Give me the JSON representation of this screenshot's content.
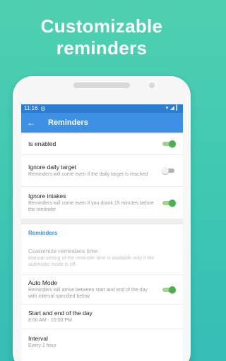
{
  "headline": {
    "line1": "Customizable",
    "line2": "reminders"
  },
  "status_bar": {
    "time": "11:16",
    "app_icon": "notification-icon",
    "icons": [
      "wifi-icon",
      "signal-icon",
      "battery-icon"
    ]
  },
  "app_bar": {
    "back_icon": "arrow-left-icon",
    "title": "Reminders"
  },
  "settings": [
    {
      "title": "Is enabled",
      "description": "",
      "toggle": true
    },
    {
      "title": "Ignore daily target",
      "description": "Reminders will come even if the daily target is reached",
      "toggle": false
    },
    {
      "title": "Ignore intakes",
      "description": "Reminders will come even if you drank 15 minutes before the reminder",
      "toggle": true
    }
  ],
  "section": {
    "header": "Reminders",
    "items": [
      {
        "title": "Customize reminders time",
        "description": "Manual setting of the reminder time is available only if the automatic mode is off",
        "disabled": true
      },
      {
        "title": "Auto Mode",
        "description": "Reminders will arrive between start and end of the day with interval specified below",
        "toggle": true
      },
      {
        "title": "Start and end of the day",
        "value": "8:00 AM - 10:00 PM"
      },
      {
        "title": "Interval",
        "value": "Every 1 hour"
      }
    ]
  },
  "colors": {
    "accent": "#3d90e3",
    "status_bar": "#2b7ed4",
    "toggle_on": "#4caf50",
    "background": "#3fc7b3"
  }
}
